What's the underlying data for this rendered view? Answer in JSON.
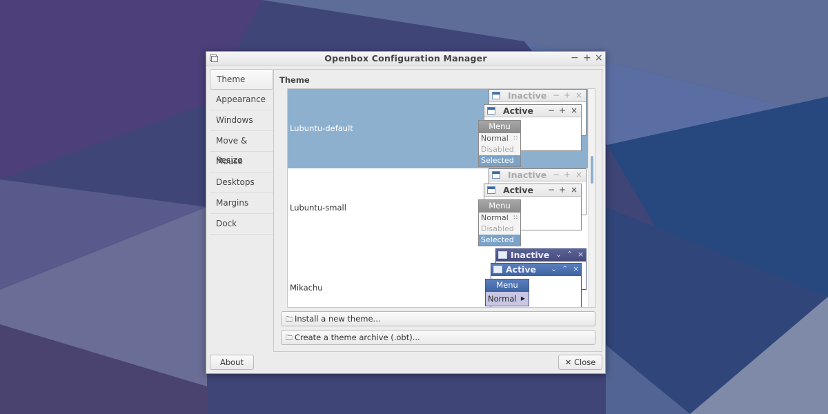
{
  "window": {
    "title": "Openbox Configuration Manager",
    "minimize": "−",
    "maximize": "+",
    "close": "×"
  },
  "sidebar": {
    "items": [
      {
        "label": "Theme",
        "active": true
      },
      {
        "label": "Appearance"
      },
      {
        "label": "Windows"
      },
      {
        "label": "Move & Resize"
      },
      {
        "label": "Mouse"
      },
      {
        "label": "Desktops"
      },
      {
        "label": "Margins"
      },
      {
        "label": "Dock"
      }
    ]
  },
  "main": {
    "section_title": "Theme",
    "themes": [
      {
        "name": "Lubuntu-default",
        "selected": true
      },
      {
        "name": "Lubuntu-small"
      },
      {
        "name": "Mikachu"
      }
    ],
    "preview": {
      "inactive_label": "Inactive",
      "active_label": "Active",
      "menu_label": "Menu",
      "menu_items": [
        "Normal",
        "Disabled",
        "Selected"
      ]
    },
    "install_button": "Install a new theme...",
    "archive_button": "Create a theme archive (.obt)..."
  },
  "footer": {
    "about_button": "About",
    "close_button": "Close"
  },
  "icons": {
    "window-icon": "window-icon",
    "folder-icon": "folder-icon",
    "close-icon": "close-icon"
  },
  "colors": {
    "selection": "#8eb0cf",
    "menu_selected": "#7ba2c9",
    "mikachu_active": "#3e63a2",
    "mikachu_inactive": "#44497a"
  }
}
